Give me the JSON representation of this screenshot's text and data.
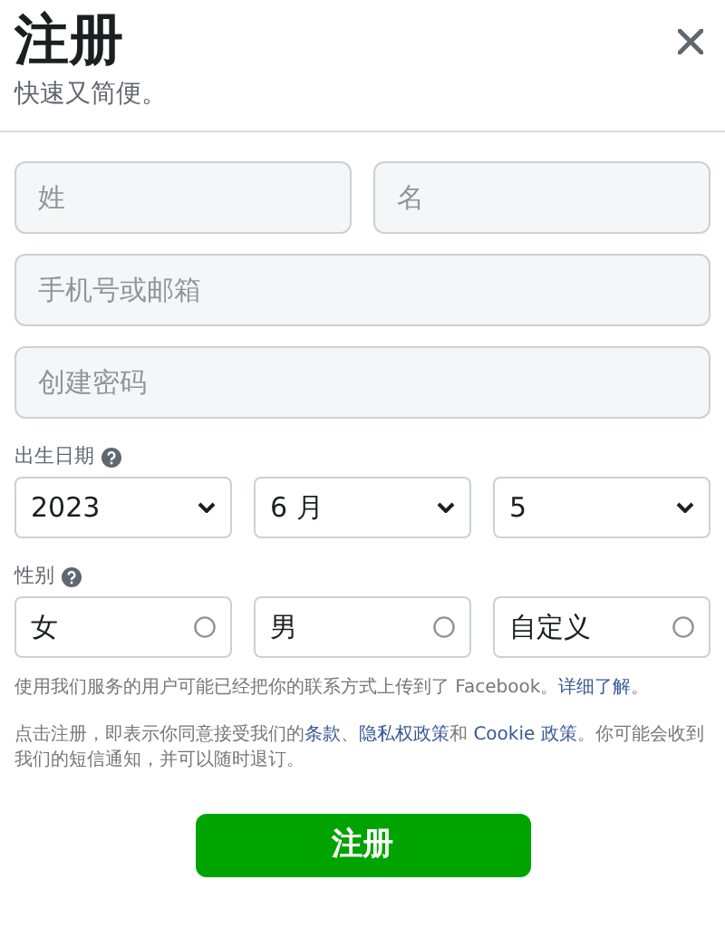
{
  "header": {
    "title": "注册",
    "subtitle": "快速又简便。"
  },
  "name_fields": [
    {
      "placeholder": "姓"
    },
    {
      "placeholder": "名"
    }
  ],
  "fields": [
    {
      "placeholder": "手机号或邮箱"
    },
    {
      "placeholder": "创建密码"
    }
  ],
  "birthday": {
    "label": "出生日期",
    "selects": [
      {
        "value": "2023"
      },
      {
        "value": "6 月"
      },
      {
        "value": "5"
      }
    ]
  },
  "gender": {
    "label": "性别",
    "options": [
      {
        "label": "女",
        "selected": false
      },
      {
        "label": "男",
        "selected": false
      },
      {
        "label": "自定义",
        "selected": false
      }
    ]
  },
  "notices": [
    {
      "parts": [
        {
          "text": "使用我们服务的用户可能已经把你的联系方式上传到了 Facebook。",
          "link": false
        },
        {
          "text": "详细了解",
          "link": true
        },
        {
          "text": "。",
          "link": false
        }
      ]
    },
    {
      "parts": [
        {
          "text": "点击注册，即表示你同意接受我们的",
          "link": false
        },
        {
          "text": "条款",
          "link": true
        },
        {
          "text": "、",
          "link": false
        },
        {
          "text": "隐私权政策",
          "link": true
        },
        {
          "text": "和 ",
          "link": false
        },
        {
          "text": "Cookie 政策",
          "link": true
        },
        {
          "text": "。你可能会收到我们的短信通知，并可以随时退订。",
          "link": false
        }
      ]
    }
  ],
  "submit_button": "注册"
}
